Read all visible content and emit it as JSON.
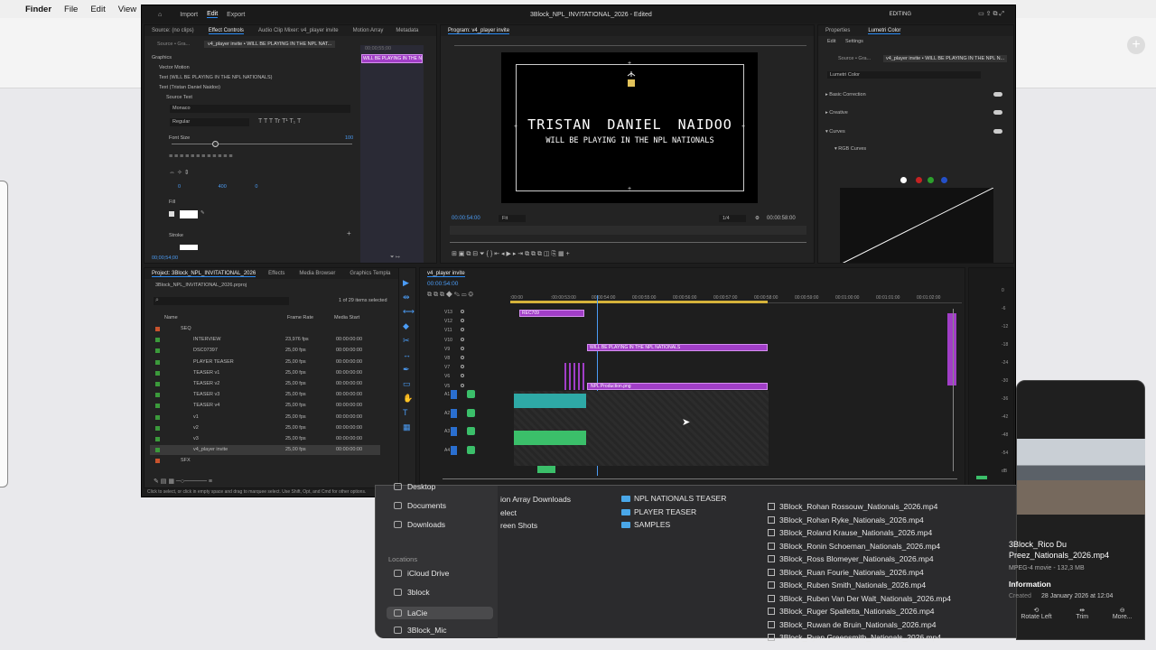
{
  "menubar": {
    "apple": "",
    "app": "Finder",
    "file": "File",
    "edit": "Edit",
    "view": "View"
  },
  "premiere": {
    "nav": {
      "home": "",
      "import": "Import",
      "edit": "Edit",
      "export": "Export",
      "title": "3Block_NPL_INVITATIONAL_2026 - Edited",
      "workspace": "EDITING"
    },
    "source_tabs": [
      "Source: (no clips)",
      "Effect Controls",
      "Audio Clip Mixer: v4_player invite",
      "Motion Array",
      "Metadata"
    ],
    "ec": {
      "source": "Source • Gra...",
      "clip": "v4_player invite • WILL BE PLAYING IN THE NPL NAT...",
      "mini_clip": "WILL BE PLAYING IN THE N",
      "mini_time": "00;00;55;00",
      "graphics": "Graphics",
      "vector_motion": "Vector Motion",
      "text1": "Text (WILL BE PLAYING IN THE NPL NATIONALS)",
      "text2": "Text (Tristan  Daniel Naidoo)",
      "source_text": "Source Text",
      "font": "Monaco",
      "style": "Regular",
      "font_size_label": "Font Size",
      "font_size_val": "100",
      "v1": "0",
      "v2": "400",
      "v3": "0",
      "v4": "0",
      "v5": "0",
      "fill": "Fill",
      "stroke": "Stroke",
      "timecode": "00;00;54;00"
    },
    "program": {
      "tab": "Program: v4_player invite",
      "name": "TRISTAN  DANIEL NAIDOO",
      "sub": "WILL BE PLAYING IN THE NPL NATIONALS",
      "tc": "00:00:54:00",
      "fit": "Fit",
      "res": "1/4",
      "dur": "00:00:58:00"
    },
    "lumetri": {
      "tabs": [
        "Properties",
        "Lumetri Color"
      ],
      "sub": [
        "Edit",
        "Settings"
      ],
      "source": "Source • Gra...",
      "clip": "v4_player invite • WILL BE PLAYING IN THE NPL N...",
      "preset": "Lumetri Color",
      "basic": "Basic Correction",
      "creative": "Creative",
      "curves": "Curves",
      "rgb": "RGB Curves"
    },
    "project": {
      "tabs": [
        "Project: 3Block_NPL_INVITATIONAL_2026",
        "Effects",
        "Media Browser",
        "Graphics Templa"
      ],
      "file": "3Block_NPL_INVITATIONAL_2026.prproj",
      "count": "1 of 29 items selected",
      "cols": [
        "Name",
        "Frame Rate",
        "Media Start"
      ],
      "items": [
        {
          "name": "SEQ",
          "fps": "",
          "start": ""
        },
        {
          "name": "INTERVIEW",
          "fps": "23,976 fps",
          "start": "00:00:00:00"
        },
        {
          "name": "DSC07397",
          "fps": "25,00 fps",
          "start": "00:00:00:00"
        },
        {
          "name": "PLAYER TEASER",
          "fps": "25,00 fps",
          "start": "00:00:00:00"
        },
        {
          "name": "TEASER v1",
          "fps": "25,00 fps",
          "start": "00:00:00:00"
        },
        {
          "name": "TEASER v2",
          "fps": "25,00 fps",
          "start": "00:00:00:00"
        },
        {
          "name": "TEASER v3",
          "fps": "25,00 fps",
          "start": "00:00:00:00"
        },
        {
          "name": "TEASER v4",
          "fps": "25,00 fps",
          "start": "00:00:00:00"
        },
        {
          "name": "v1",
          "fps": "25,00 fps",
          "start": "00:00:00:00"
        },
        {
          "name": "v2",
          "fps": "25,00 fps",
          "start": "00:00:00:00"
        },
        {
          "name": "v3",
          "fps": "25,00 fps",
          "start": "00:00:00:00"
        },
        {
          "name": "v4_player invite",
          "fps": "25,00 fps",
          "start": "00:00:00:00"
        },
        {
          "name": "SFX",
          "fps": "",
          "start": ""
        }
      ]
    },
    "timeline": {
      "tab": "v4_player invite",
      "tc": "00:00:54:00",
      "ruler": [
        ":00:00",
        ":00:00:53:00",
        "00:00:54:00",
        "00:00:55:00",
        "00:00:56:00",
        "00:00:57:00",
        "00:00:58:00",
        "00:00:59:00",
        "00:01:00:00",
        "00:01:01:00",
        "00:01:02:00"
      ],
      "tracks": [
        "V13",
        "V12",
        "V11",
        "V10",
        "V9",
        "V8",
        "V7",
        "V6",
        "V5",
        "A1",
        "A2",
        "A3",
        "A4"
      ],
      "clips": {
        "rec": "REC709",
        "will": "WILL BE PLAYING IN THE NPL NATIONALS",
        "npl": "NPL Production.png"
      }
    },
    "meter": [
      "0",
      "-6",
      "-12",
      "-18",
      "-24",
      "-30",
      "-36",
      "-42",
      "-48",
      "-54",
      "dB"
    ],
    "status": "Click to select, or click in empty space and drag to marquee select. Use Shift, Opt, and Cmd for other options."
  },
  "finder": {
    "sidebar": [
      {
        "label": "Desktop"
      },
      {
        "label": "Documents"
      },
      {
        "label": "Downloads"
      }
    ],
    "locations_head": "Locations",
    "locations": [
      {
        "label": "iCloud Drive"
      },
      {
        "label": "3block"
      },
      {
        "label": "LaCie"
      },
      {
        "label": "3Block_Mic"
      }
    ],
    "col2": [
      "ion Array Downloads",
      "elect",
      "reen Shots"
    ],
    "col3": [
      "NPL NATIONALS TEASER",
      "PLAYER TEASER",
      "SAMPLES"
    ],
    "files": [
      "3Block_Rohan Rossouw_Nationals_2026.mp4",
      "3Block_Rohan Ryke_Nationals_2026.mp4",
      "3Block_Roland Krause_Nationals_2026.mp4",
      "3Block_Ronin Schoeman_Nationals_2026.mp4",
      "3Block_Ross Blomeyer_Nationals_2026.mp4",
      "3Block_Ruan Fourie_Nationals_2026.mp4",
      "3Block_Ruben Smith_Nationals_2026.mp4",
      "3Block_Ruben Van Der Walt_Nationals_2026.mp4",
      "3Block_Ruger Spalletta_Nationals_2026.mp4",
      "3Block_Ruwan de Bruin_Nationals_2026.mp4",
      "3Block_Ryan Greensmith_Nationals_2026.mp4"
    ],
    "preview": {
      "name": "3Block_Rico Du Preez_Nationals_2026.mp4",
      "kind": "MPEG-4 movie - 132,3 MB",
      "info": "Information",
      "created": "Created",
      "created_val": "28 January 2026 at 12:04",
      "actions": [
        "Rotate Left",
        "Trim",
        "More..."
      ]
    }
  },
  "colors": {
    "accent": "#2a8cf7",
    "purple": "#a13ec7",
    "green": "#3bbf6a",
    "teal": "#2ea9a6"
  }
}
